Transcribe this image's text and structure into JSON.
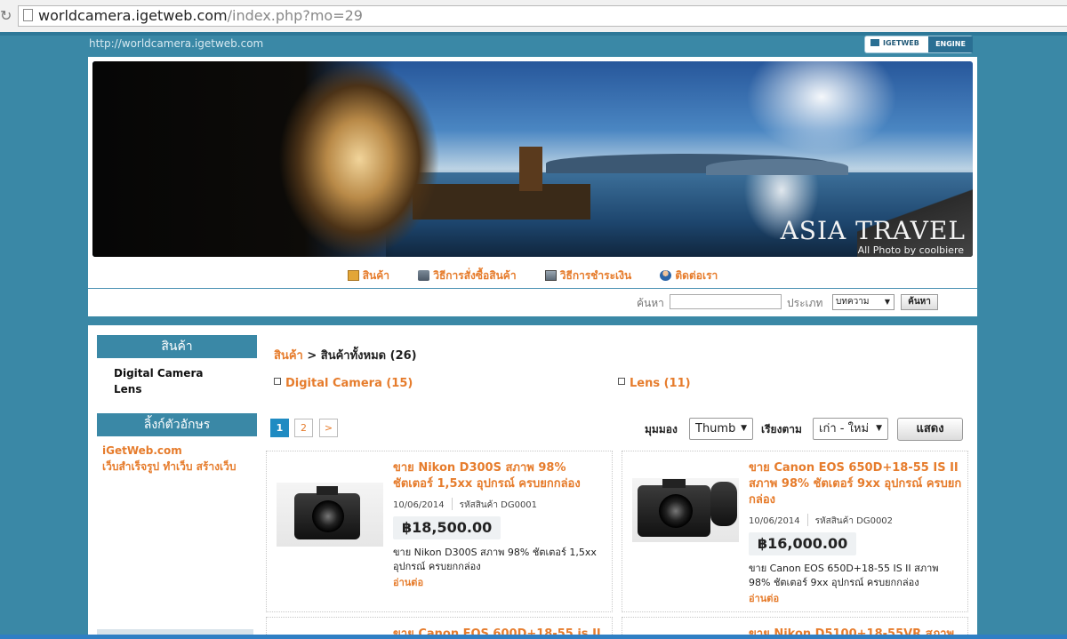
{
  "browser": {
    "url_host": "worldcamera.igetweb.com",
    "url_path": "/index.php?mo=29"
  },
  "site": {
    "url_text": "http://worldcamera.igetweb.com",
    "engine_badge": {
      "left": "IGETWEB",
      "right": "ENGINE"
    },
    "banner": {
      "title": "ASIA TRAVEL",
      "subtitle": "All Photo by coolbiere"
    }
  },
  "nav": [
    {
      "label": "สินค้า",
      "icon": "box-icon"
    },
    {
      "label": "วิธีการสั่งซื้อสินค้า",
      "icon": "cart-icon"
    },
    {
      "label": "วิธีการชำระเงิน",
      "icon": "payment-icon"
    },
    {
      "label": "ติดต่อเรา",
      "icon": "person-icon"
    }
  ],
  "search": {
    "label": "ค้นหา",
    "type_label": "ประเภท",
    "type_value": "บทความ",
    "button": "ค้นหา"
  },
  "sidebar": {
    "products_header": "สินค้า",
    "products": [
      "Digital Camera",
      "Lens"
    ],
    "links_header": "ลิ้งก์ตัวอักษร",
    "links": [
      "iGetWeb.com",
      "เว็บสำเร็จรูป ทำเว็บ สร้างเว็บ"
    ]
  },
  "content": {
    "breadcrumb_root": "สินค้า",
    "breadcrumb_sep": " > ",
    "breadcrumb_current": "สินค้าทั้งหมด (26)",
    "categories": [
      "Digital Camera (15)",
      "Lens (11)"
    ],
    "pagination": [
      "1",
      "2",
      ">"
    ],
    "view_label": "มุมมอง",
    "view_value": "Thumb",
    "sort_label": "เรียงตาม",
    "sort_value": "เก่า - ใหม่",
    "show_button": "แสดง"
  },
  "products": [
    {
      "title": "ขาย Nikon D300S สภาพ 98% ชัตเตอร์ 1,5xx อุปกรณ์ ครบยกกล่อง",
      "date": "10/06/2014",
      "code": "รหัสสินค้า DG0001",
      "price": "฿18,500.00",
      "desc": "ขาย Nikon D300S สภาพ 98% ชัตเตอร์ 1,5xx อุปกรณ์ ครบยกกล่อง",
      "more": "อ่านต่อ"
    },
    {
      "title": "ขาย Canon EOS 650D+18-55 IS II สภาพ 98% ชัตเตอร์ 9xx อุปกรณ์ ครบยกกล่อง",
      "date": "10/06/2014",
      "code": "รหัสสินค้า DG0002",
      "price": "฿16,000.00",
      "desc": "ขาย Canon EOS 650D+18-55 IS II สภาพ 98% ชัตเตอร์ 9xx อุปกรณ์ ครบยกกล่อง",
      "more": "อ่านต่อ"
    },
    {
      "title": "ขาย Canon EOS 600D+18-55 is II"
    },
    {
      "title": "ขาย Nikon D5100+18-55VR สภาพ"
    }
  ]
}
